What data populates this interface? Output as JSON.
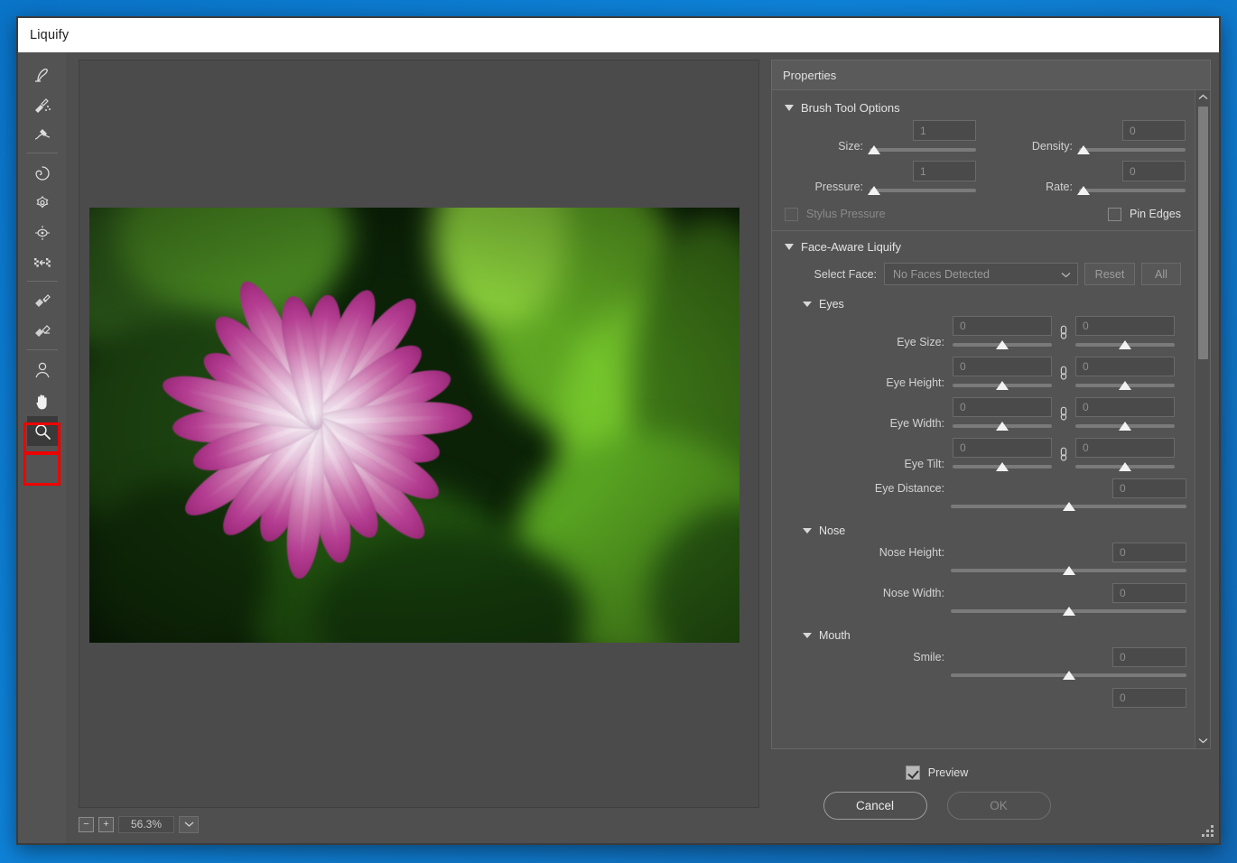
{
  "window": {
    "title": "Liquify"
  },
  "toolbar": {
    "tools": [
      {
        "name": "forward-warp-tool",
        "selected": false
      },
      {
        "name": "reconstruct-tool",
        "selected": false
      },
      {
        "name": "smooth-tool",
        "selected": false
      },
      {
        "name": "twirl-clockwise-tool",
        "selected": false
      },
      {
        "name": "pucker-tool",
        "selected": false
      },
      {
        "name": "bloat-tool",
        "selected": false
      },
      {
        "name": "push-left-tool",
        "selected": false
      },
      {
        "name": "freeze-mask-tool",
        "selected": false
      },
      {
        "name": "thaw-mask-tool",
        "selected": false
      },
      {
        "name": "face-tool",
        "selected": false
      },
      {
        "name": "hand-tool",
        "selected": false
      },
      {
        "name": "zoom-tool",
        "selected": true
      }
    ],
    "annotation_color": "#ef0000"
  },
  "canvas": {
    "zoom_level": "56.3%",
    "zoom_out_label": "−",
    "zoom_in_label": "+",
    "image_alt": "purple african daisy flower on green foliage"
  },
  "properties": {
    "header": "Properties",
    "brush_tool_options": {
      "title": "Brush Tool Options",
      "fields": [
        {
          "label": "Size:",
          "value": "1"
        },
        {
          "label": "Density:",
          "value": "0"
        },
        {
          "label": "Pressure:",
          "value": "1"
        },
        {
          "label": "Rate:",
          "value": "0"
        }
      ],
      "stylus_pressure": {
        "label": "Stylus Pressure",
        "checked": false,
        "enabled": false
      },
      "pin_edges": {
        "label": "Pin Edges",
        "checked": false,
        "enabled": true
      }
    },
    "face_aware_liquify": {
      "title": "Face-Aware Liquify",
      "select_face": {
        "label": "Select Face:",
        "value": "No Faces Detected",
        "reset_label": "Reset",
        "all_label": "All"
      },
      "eyes": {
        "title": "Eyes",
        "paired": [
          {
            "label": "Eye Size:",
            "left": "0",
            "right": "0"
          },
          {
            "label": "Eye Height:",
            "left": "0",
            "right": "0"
          },
          {
            "label": "Eye Width:",
            "left": "0",
            "right": "0"
          },
          {
            "label": "Eye Tilt:",
            "left": "0",
            "right": "0"
          }
        ],
        "single": [
          {
            "label": "Eye Distance:",
            "value": "0"
          }
        ]
      },
      "nose": {
        "title": "Nose",
        "single": [
          {
            "label": "Nose Height:",
            "value": "0"
          },
          {
            "label": "Nose Width:",
            "value": "0"
          }
        ]
      },
      "mouth": {
        "title": "Mouth",
        "single": [
          {
            "label": "Smile:",
            "value": "0"
          }
        ],
        "clipped": {
          "value": "0"
        }
      }
    }
  },
  "footer": {
    "preview": {
      "label": "Preview",
      "checked": true
    },
    "cancel_label": "Cancel",
    "ok_label": "OK"
  }
}
